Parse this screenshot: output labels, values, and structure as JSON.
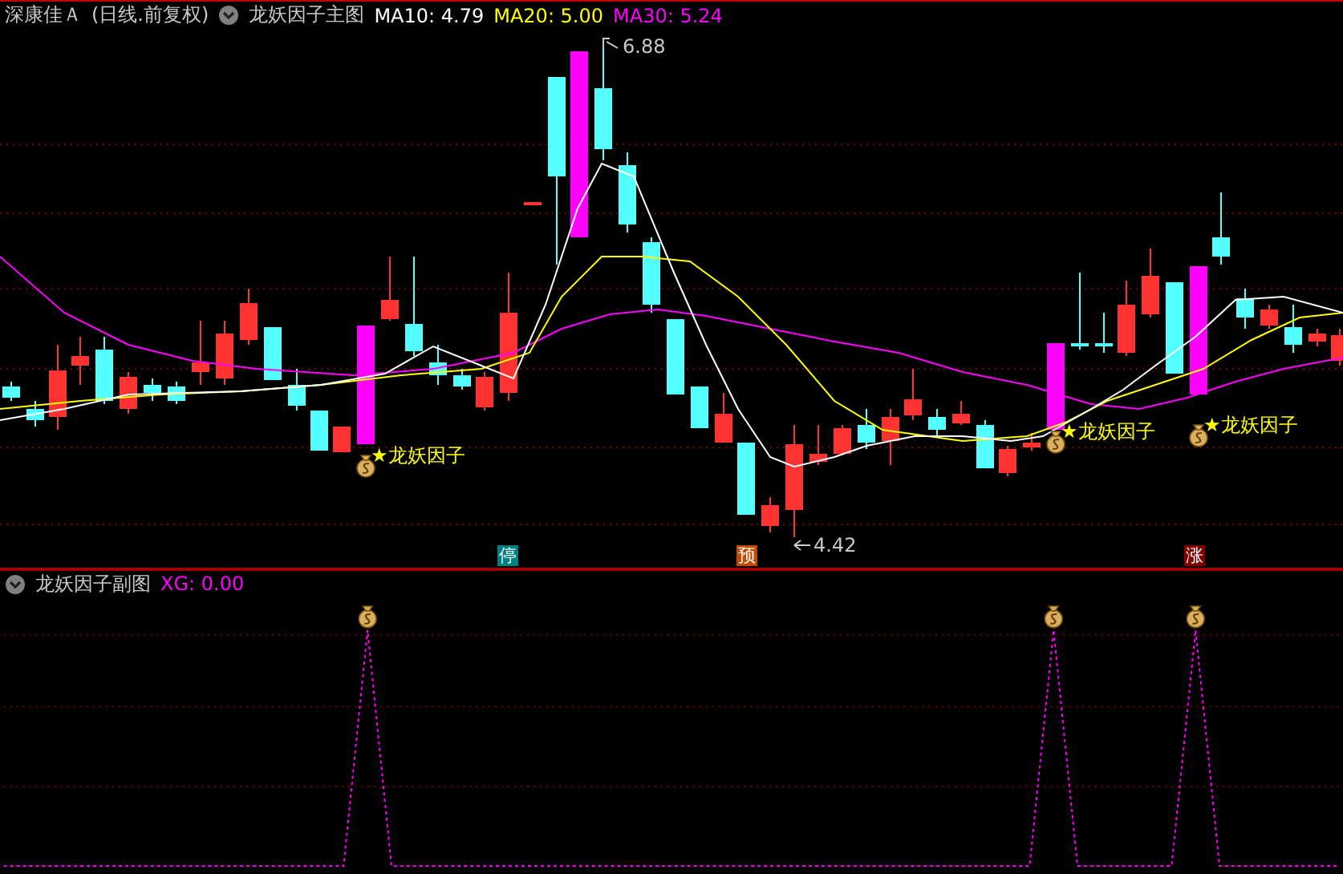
{
  "header": {
    "stock": "深康佳Ａ",
    "period": "(日线.前复权)",
    "indicator": "龙妖因子主图",
    "ma": [
      {
        "label": "MA10: 4.79",
        "color": "#ffffff"
      },
      {
        "label": "MA20: 5.00",
        "color": "#ffff00"
      },
      {
        "label": "MA30: 5.24",
        "color": "#ff00ff"
      }
    ]
  },
  "main_chart": {
    "high_label": "6.88",
    "low_label": "4.42",
    "signals": [
      {
        "label": "★龙妖因子"
      },
      {
        "label": "★龙妖因子"
      },
      {
        "label": "★龙妖因子"
      }
    ],
    "badges": [
      {
        "text": "停",
        "color": "#008080"
      },
      {
        "text": "预",
        "color": "#c04a00"
      },
      {
        "text": "涨",
        "color": "#800000"
      }
    ]
  },
  "sub_chart": {
    "title": "龙妖因子副图",
    "reading": "XG: 0.00"
  }
}
